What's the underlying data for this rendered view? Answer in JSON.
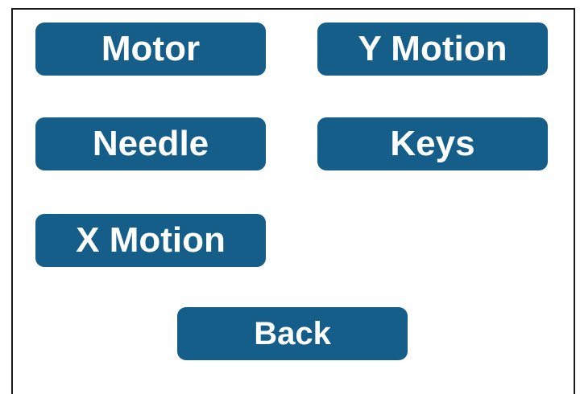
{
  "buttons": {
    "motor": "Motor",
    "y_motion": "Y Motion",
    "needle": "Needle",
    "keys": "Keys",
    "x_motion": "X Motion",
    "back": "Back"
  },
  "colors": {
    "button_background": "#155e8a",
    "button_text": "#ffffff",
    "border": "#1a1a1a",
    "background": "#ffffff"
  }
}
